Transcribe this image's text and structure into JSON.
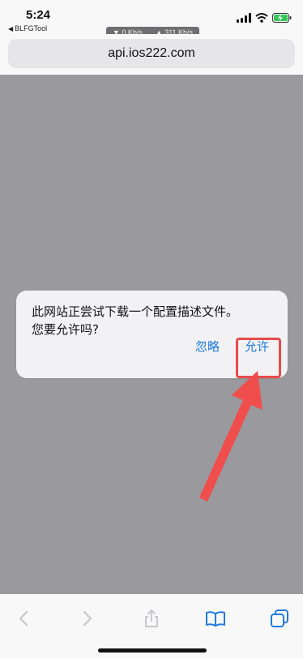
{
  "status_bar": {
    "time": "5:24",
    "back_app": "BLFGTool",
    "download_speed": "0 Kb/s",
    "upload_speed": "311 Kb/s"
  },
  "browser": {
    "url": "api.ios222.com"
  },
  "alert": {
    "message_line1": "此网站正尝试下载一个配置描述文件。",
    "message_line2": "您要允许吗?",
    "ignore_label": "忽略",
    "allow_label": "允许"
  },
  "annotation": {
    "highlight_color": "#e84b4b"
  },
  "toolbar": {
    "icons": [
      "back-icon",
      "forward-icon",
      "share-icon",
      "bookmarks-icon",
      "tabs-icon"
    ]
  },
  "colors": {
    "accent": "#1f7ae0",
    "overlay": "#9a999d"
  }
}
